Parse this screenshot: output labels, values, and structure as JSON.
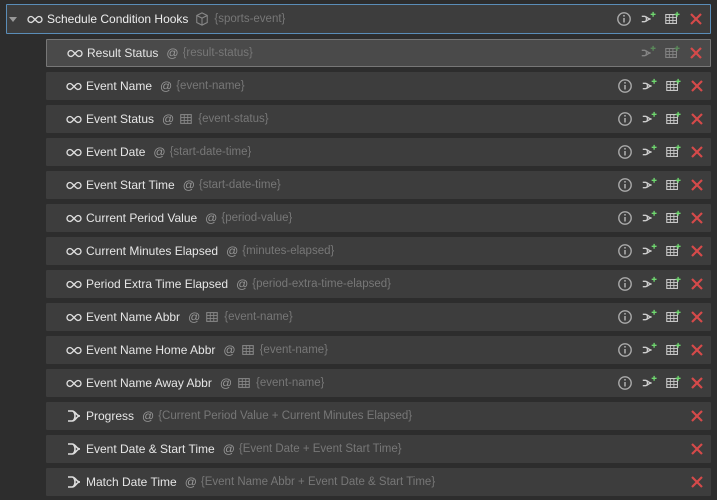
{
  "header": {
    "label": "Schedule Condition Hooks",
    "binding": "{sports-event}"
  },
  "rows": [
    {
      "type": "link",
      "highlight": true,
      "label": "Result Status",
      "binding": "{result-status}",
      "hasGrid": false,
      "actionsGhost": true,
      "showInfo": false
    },
    {
      "type": "link",
      "highlight": false,
      "label": "Event Name",
      "binding": "{event-name}",
      "hasGrid": false,
      "actionsGhost": false,
      "showInfo": true
    },
    {
      "type": "link",
      "highlight": false,
      "label": "Event Status",
      "binding": "{event-status}",
      "hasGrid": true,
      "actionsGhost": false,
      "showInfo": true
    },
    {
      "type": "link",
      "highlight": false,
      "label": "Event Date",
      "binding": "{start-date-time}",
      "hasGrid": false,
      "actionsGhost": false,
      "showInfo": true
    },
    {
      "type": "link",
      "highlight": false,
      "label": "Event Start Time",
      "binding": "{start-date-time}",
      "hasGrid": false,
      "actionsGhost": false,
      "showInfo": true
    },
    {
      "type": "link",
      "highlight": false,
      "label": "Current Period Value",
      "binding": "{period-value}",
      "hasGrid": false,
      "actionsGhost": false,
      "showInfo": true
    },
    {
      "type": "link",
      "highlight": false,
      "label": "Current Minutes Elapsed",
      "binding": "{minutes-elapsed}",
      "hasGrid": false,
      "actionsGhost": false,
      "showInfo": true
    },
    {
      "type": "link",
      "highlight": false,
      "label": "Period Extra Time Elapsed",
      "binding": "{period-extra-time-elapsed}",
      "hasGrid": false,
      "actionsGhost": false,
      "showInfo": true
    },
    {
      "type": "link",
      "highlight": false,
      "label": "Event Name Abbr",
      "binding": "{event-name}",
      "hasGrid": true,
      "actionsGhost": false,
      "showInfo": true
    },
    {
      "type": "link",
      "highlight": false,
      "label": "Event Name Home Abbr",
      "binding": "{event-name}",
      "hasGrid": true,
      "actionsGhost": false,
      "showInfo": true
    },
    {
      "type": "link",
      "highlight": false,
      "label": "Event Name Away Abbr",
      "binding": "{event-name}",
      "hasGrid": true,
      "actionsGhost": false,
      "showInfo": true
    },
    {
      "type": "group",
      "highlight": false,
      "label": "Progress",
      "binding": "{Current Period Value + Current Minutes Elapsed}"
    },
    {
      "type": "group",
      "highlight": false,
      "label": "Event Date & Start Time",
      "binding": "{Event Date + Event Start Time}"
    },
    {
      "type": "group",
      "highlight": false,
      "label": "Match Date Time",
      "binding": "{Event Name Abbr + Event Date & Start Time}"
    }
  ]
}
